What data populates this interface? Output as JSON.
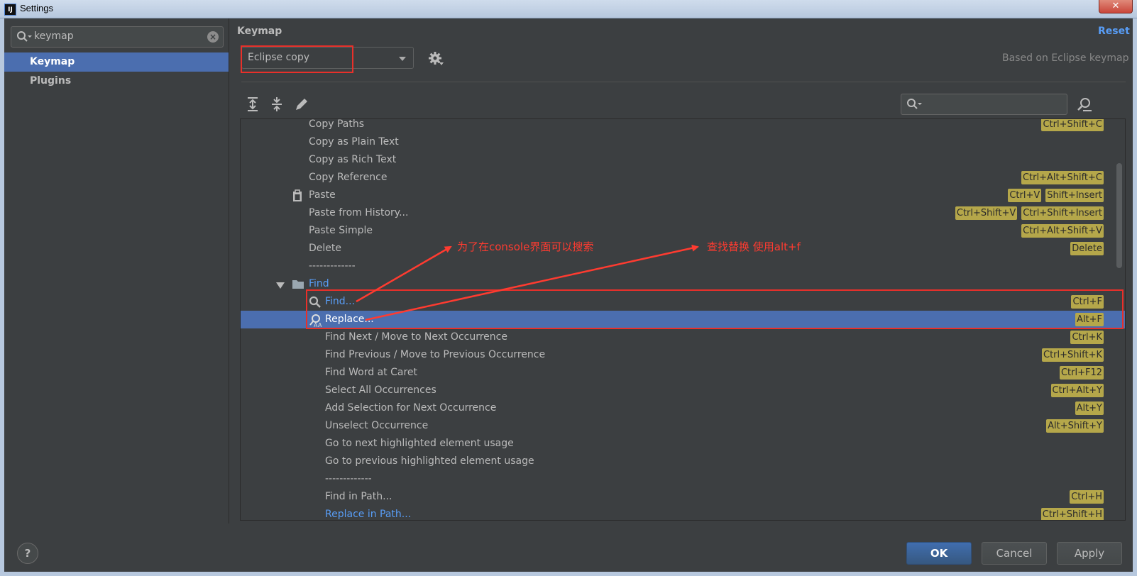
{
  "window": {
    "title": "Settings",
    "app_icon": "IJ",
    "close_label": "✕"
  },
  "sidebar": {
    "search_value": "keymap",
    "items": [
      {
        "label": "Keymap",
        "selected": true
      },
      {
        "label": "Plugins",
        "selected": false
      }
    ]
  },
  "header": {
    "title": "Keymap",
    "reset_label": "Reset",
    "keymap_selected": "Eclipse copy",
    "based_on": "Based on Eclipse keymap"
  },
  "actions": [
    {
      "label": "Copy Paths",
      "keys": [
        "Ctrl+Shift+C"
      ],
      "indent": 1
    },
    {
      "label": "Copy as Plain Text",
      "keys": [],
      "indent": 1
    },
    {
      "label": "Copy as Rich Text",
      "keys": [],
      "indent": 1
    },
    {
      "label": "Copy Reference",
      "keys": [
        "Ctrl+Alt+Shift+C"
      ],
      "indent": 1
    },
    {
      "label": "Paste",
      "keys": [
        "Ctrl+V",
        "Shift+Insert"
      ],
      "indent": 1,
      "icon": "clipboard-icon"
    },
    {
      "label": "Paste from History...",
      "keys": [
        "Ctrl+Shift+V",
        "Ctrl+Shift+Insert"
      ],
      "indent": 1
    },
    {
      "label": "Paste Simple",
      "keys": [
        "Ctrl+Alt+Shift+V"
      ],
      "indent": 1
    },
    {
      "label": "Delete",
      "keys": [
        "Delete"
      ],
      "indent": 1
    },
    {
      "label": "-------------",
      "keys": [],
      "indent": 1
    },
    {
      "label": "Find",
      "keys": [],
      "indent": 0,
      "group": true,
      "link": true,
      "icon": "folder-icon"
    },
    {
      "label": "Find...",
      "keys": [
        "Ctrl+F"
      ],
      "indent": 2,
      "link": true,
      "icon": "search-icon"
    },
    {
      "label": "Replace...",
      "keys": [
        "Alt+F"
      ],
      "indent": 2,
      "link": true,
      "icon": "replace-icon",
      "selected": true
    },
    {
      "label": "Find Next / Move to Next Occurrence",
      "keys": [
        "Ctrl+K"
      ],
      "indent": 2
    },
    {
      "label": "Find Previous / Move to Previous Occurrence",
      "keys": [
        "Ctrl+Shift+K"
      ],
      "indent": 2
    },
    {
      "label": "Find Word at Caret",
      "keys": [
        "Ctrl+F12"
      ],
      "indent": 2
    },
    {
      "label": "Select All Occurrences",
      "keys": [
        "Ctrl+Alt+Y"
      ],
      "indent": 2
    },
    {
      "label": "Add Selection for Next Occurrence",
      "keys": [
        "Alt+Y"
      ],
      "indent": 2
    },
    {
      "label": "Unselect Occurrence",
      "keys": [
        "Alt+Shift+Y"
      ],
      "indent": 2
    },
    {
      "label": "Go to next highlighted element usage",
      "keys": [],
      "indent": 2
    },
    {
      "label": "Go to previous highlighted element usage",
      "keys": [],
      "indent": 2
    },
    {
      "label": "-------------",
      "keys": [],
      "indent": 2
    },
    {
      "label": "Find in Path...",
      "keys": [
        "Ctrl+H"
      ],
      "indent": 2
    },
    {
      "label": "Replace in Path...",
      "keys": [
        "Ctrl+Shift+H"
      ],
      "indent": 2,
      "link": true
    }
  ],
  "annotations": {
    "note1": "为了在console界面可以搜索",
    "note2": "查找替换 使用alt+f",
    "color": "#ff3b30"
  },
  "footer": {
    "help": "?",
    "ok": "OK",
    "cancel": "Cancel",
    "apply": "Apply"
  },
  "colors": {
    "background": "#3c3f41",
    "selection": "#4b6eaf",
    "link": "#589df6",
    "shortcut": "#b5a74a"
  }
}
